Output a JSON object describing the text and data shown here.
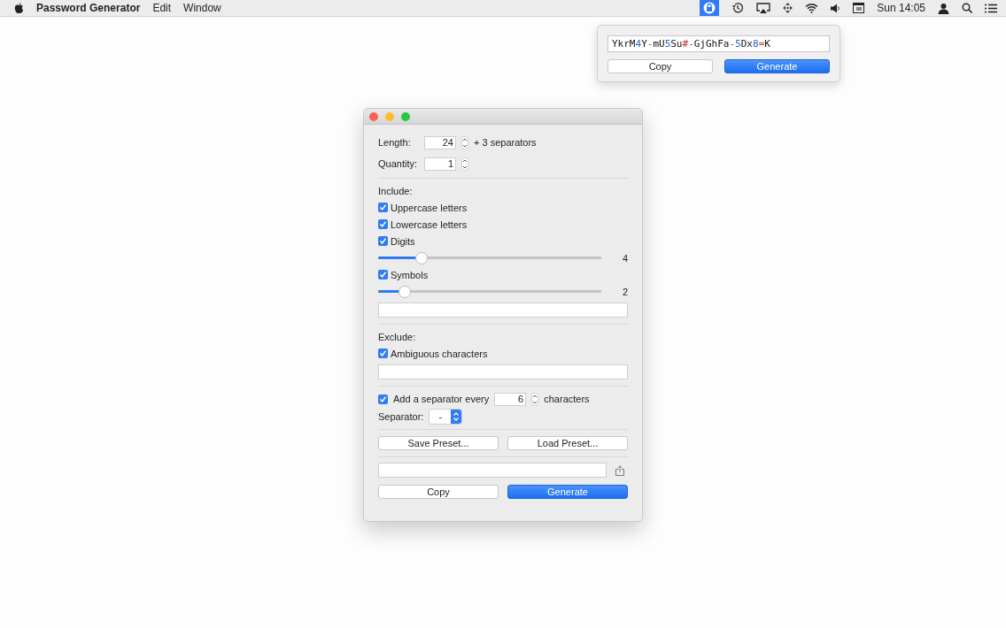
{
  "menu_bar": {
    "app_name": "Password Generator",
    "menus": [
      "Edit",
      "Window"
    ],
    "clock": "Sun 14:05"
  },
  "popover": {
    "password": [
      {
        "text": "YkrM",
        "kind": "letter"
      },
      {
        "text": "4",
        "kind": "digit"
      },
      {
        "text": "Y",
        "kind": "letter"
      },
      {
        "text": "-",
        "kind": "separator"
      },
      {
        "text": "mU",
        "kind": "letter"
      },
      {
        "text": "5",
        "kind": "digit"
      },
      {
        "text": "Su",
        "kind": "letter"
      },
      {
        "text": "#",
        "kind": "symbol"
      },
      {
        "text": "-",
        "kind": "separator"
      },
      {
        "text": "GjGhFa",
        "kind": "letter"
      },
      {
        "text": "-",
        "kind": "separator"
      },
      {
        "text": "5",
        "kind": "digit"
      },
      {
        "text": "Dx",
        "kind": "letter"
      },
      {
        "text": "8",
        "kind": "digit"
      },
      {
        "text": "=",
        "kind": "symbol"
      },
      {
        "text": "K",
        "kind": "letter"
      }
    ],
    "buttons": [
      "Copy",
      "Generate"
    ]
  },
  "window": {
    "length": {
      "label": "Length:",
      "value": "24",
      "note": "+ 3 separators"
    },
    "quantity": {
      "label": "Quantity:",
      "value": "1"
    },
    "include": {
      "heading": "Include:",
      "options": [
        {
          "label": "Uppercase letters",
          "checked": true
        },
        {
          "label": "Lowercase letters",
          "checked": true
        },
        {
          "label": "Digits",
          "checked": true,
          "level": 0.195,
          "reading": "4"
        },
        {
          "label": "Symbols",
          "checked": true,
          "level": 0.117,
          "reading": "2"
        }
      ]
    },
    "exclude": {
      "heading": "Exclude:",
      "options": [
        {
          "label": "Ambiguous characters",
          "checked": true
        }
      ]
    },
    "separator_every": {
      "label": "Add a separator every",
      "checked": true,
      "value": "6",
      "suffix": "characters"
    },
    "separator": {
      "label": "Separator:",
      "value": "-"
    },
    "preset_buttons": [
      "Save Preset...",
      "Load Preset..."
    ],
    "buttons": [
      "Copy",
      "Generate"
    ]
  }
}
